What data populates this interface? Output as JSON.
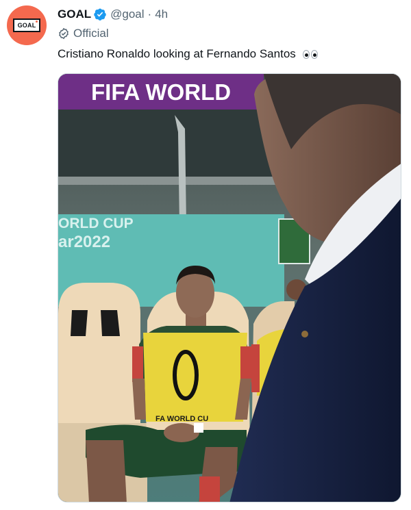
{
  "account": {
    "name": "GOAL",
    "handle": "@goal",
    "separator": "·",
    "time": "4h",
    "label": "Official",
    "logo_text": "GOAL",
    "avatar_color": "#f4694e",
    "verified_color": "#1d9bf0"
  },
  "tweet": {
    "text": "Cristiano Ronaldo looking at Fernando Santos"
  },
  "media": {
    "banner_text": "FIFA WORLD",
    "board_text_line1": "ORLD CUP",
    "board_text_line2": "ar2022",
    "vest_text": "FA WORLD CU"
  },
  "colors": {
    "banner": "#6e2f86",
    "board": "#5fbcb4",
    "vest": "#e8d43c",
    "seat": "#eed9b8",
    "suit": "#1c2748"
  }
}
